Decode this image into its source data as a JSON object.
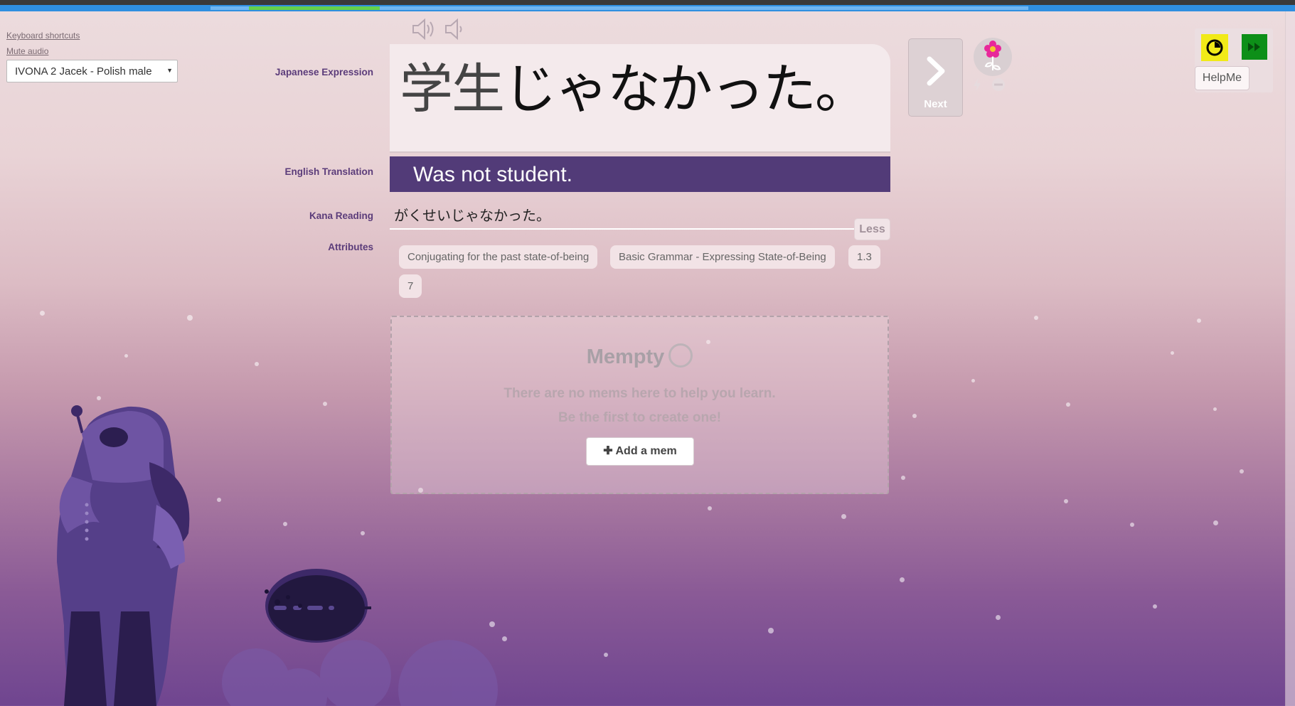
{
  "progress": {
    "fraction": 0.16
  },
  "sidebar": {
    "keyboard_shortcuts": "Keyboard shortcuts",
    "mute_audio": "Mute audio",
    "voice_selected": "IVONA 2 Jacek - Polish male"
  },
  "labels": {
    "japanese_expression": "Japanese Expression",
    "english_translation": "English Translation",
    "kana_reading": "Kana Reading",
    "attributes": "Attributes"
  },
  "card": {
    "japanese_kanji": "学生",
    "japanese_kana": "じゃなかった。",
    "english": "Was not student.",
    "kana_reading": "がくせいじゃなかった。",
    "less_label": "Less",
    "attributes": [
      "Conjugating for the past state-of-being",
      "Basic Grammar - Expressing State-of-Being",
      "1.3",
      "7"
    ]
  },
  "mems": {
    "title": "Mempty",
    "line1": "There are no mems here to help you learn.",
    "line2": "Be the first to create one!",
    "add_label": "Add a mem"
  },
  "controls": {
    "next_label": "Next",
    "helpme_label": "HelpMe"
  },
  "colors": {
    "accent_purple": "#523b78",
    "progress_blue": "#2f8fe0",
    "progress_green": "#64d24a",
    "clock_yellow": "#f1ea18",
    "skip_green": "#0d8f18"
  }
}
